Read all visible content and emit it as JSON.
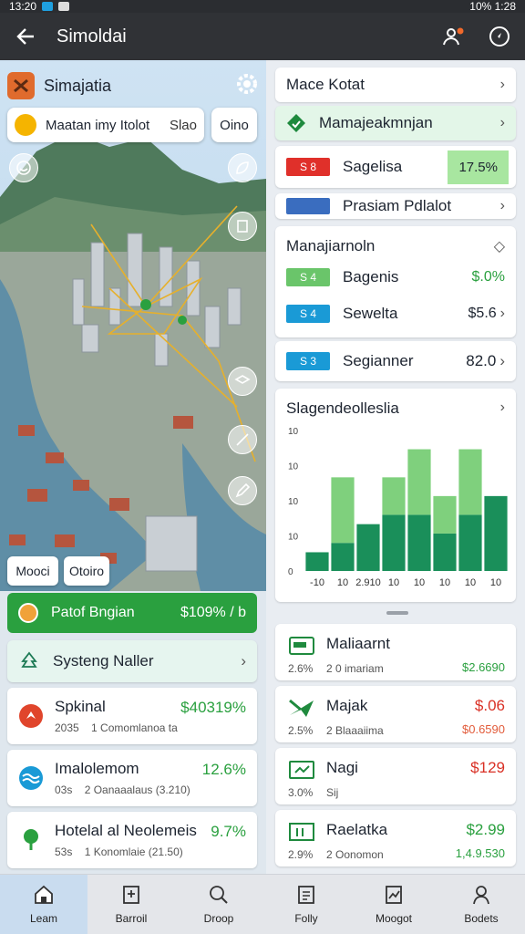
{
  "status": {
    "time": "13:20",
    "right": "10% 1:28"
  },
  "appbar": {
    "title": "Simoldai"
  },
  "map": {
    "app_name": "Simajatia",
    "search_value": "Maatan imy Itolot",
    "search_suffix": "Slao",
    "option_button": "Oino",
    "chip_left": "Mooci",
    "chip_right": "Otoiro"
  },
  "left": {
    "green_bar": {
      "label": "Patof Bngian",
      "value": "$109% / b"
    },
    "systems_header": "Systeng Naller",
    "items": [
      {
        "title": "Spkinal",
        "sub1": "2035",
        "sub2": "1 Comomlanoa ta",
        "value": "$40319%"
      },
      {
        "title": "Imalolemom",
        "sub1": "03s",
        "sub2": "2 Oanaaalaus (3.210)",
        "value": "12.6%"
      },
      {
        "title": "Hotelal al Neolemeis",
        "sub1": "53s",
        "sub2": "1 Konomlaie (21.50)",
        "value": "9.7%"
      }
    ]
  },
  "right": {
    "header": "Mace Kotat",
    "highlight": "Mamajeakmnjan",
    "row1": {
      "tag": "S 8",
      "label": "Sagelisa",
      "value": "17.5%"
    },
    "row2": {
      "label": "Prasiam Pdlalot"
    },
    "section_title": "Manajiarnoln",
    "rows": [
      {
        "tag": "S 4",
        "label": "Bagenis",
        "value": "$.0%"
      },
      {
        "tag": "S 4",
        "label": "Sewelta",
        "value": "$5.6"
      },
      {
        "tag": "S 3",
        "label": "Segianner",
        "value": "82.0"
      }
    ],
    "fin_items": [
      {
        "title": "Maliaarnt",
        "sub1": "2.6%",
        "sub2": "2 0 imariam",
        "value": "",
        "value2": "$2.6690"
      },
      {
        "title": "Majak",
        "sub1": "2.5%",
        "sub2": "2 Blaaaiima",
        "value": "$.06",
        "value2": "$0.6590"
      },
      {
        "title": "Nagi",
        "sub1": "3.0%",
        "sub2": "Sij",
        "value": "$129",
        "value2": ""
      },
      {
        "title": "Raelatka",
        "sub1": "2.9%",
        "sub2": "2 Oonomon",
        "value": "$2.99",
        "value2": "1,4.9.530"
      }
    ]
  },
  "chart_data": {
    "type": "bar",
    "title": "Slagendeolleslia",
    "yticks": [
      "10",
      "10",
      "10",
      "10",
      "0"
    ],
    "categories": [
      "-10",
      "10",
      "2.910",
      "10",
      "10",
      "10",
      "10",
      "10"
    ],
    "series": [
      {
        "values": [
          2,
          3,
          5,
          6,
          6,
          4,
          6,
          8
        ]
      },
      {
        "values": [
          0,
          7,
          0,
          4,
          7,
          4,
          7,
          0
        ]
      }
    ],
    "ylim": [
      0,
      15
    ]
  },
  "nav": [
    {
      "label": "Leam"
    },
    {
      "label": "Barroil"
    },
    {
      "label": "Droop"
    },
    {
      "label": "Folly"
    },
    {
      "label": "Moogot"
    },
    {
      "label": "Bodets"
    }
  ],
  "colors": {
    "accent_green": "#2aa03f",
    "red": "#d93025",
    "blue": "#1a9ad6",
    "chart_light": "#7fd07d",
    "chart_dark": "#1a8f5a"
  }
}
